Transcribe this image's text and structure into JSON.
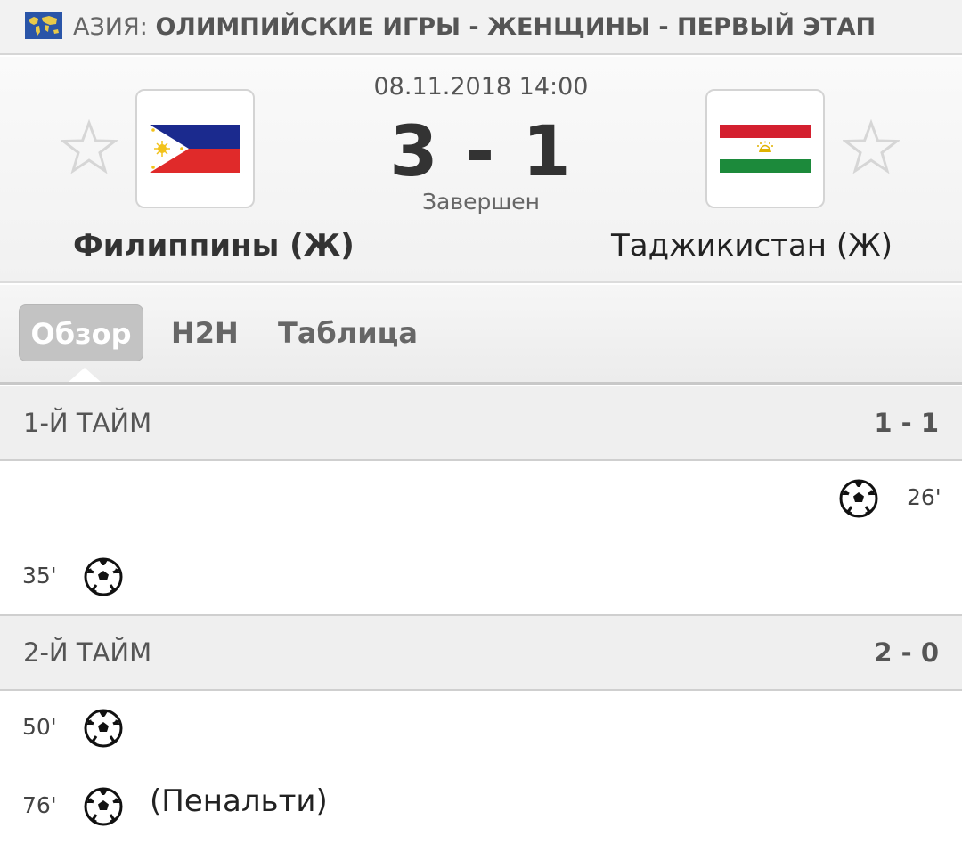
{
  "league": {
    "country": "АЗИЯ:",
    "name": "ОЛИМПИЙСКИЕ ИГРЫ - ЖЕНЩИНЫ - ПЕРВЫЙ ЭТАП",
    "icon": "world-map-icon"
  },
  "match": {
    "datetime": "08.11.2018 14:00",
    "score": "3 - 1",
    "status": "Завершен",
    "home": {
      "name": "Филиппины (Ж)",
      "flag": "philippines-flag"
    },
    "away": {
      "name": "Таджикистан (Ж)",
      "flag": "tajikistan-flag"
    }
  },
  "tabs": [
    {
      "label": "Обзор",
      "active": true
    },
    {
      "label": "H2H",
      "active": false
    },
    {
      "label": "Таблица",
      "active": false
    }
  ],
  "periods": [
    {
      "label": "1-Й ТАЙМ",
      "score": "1 - 1",
      "events": [
        {
          "side": "away",
          "minute": "26'",
          "type": "goal",
          "icon": "soccer-ball-icon"
        },
        {
          "side": "home",
          "minute": "35'",
          "type": "goal",
          "icon": "soccer-ball-icon"
        }
      ]
    },
    {
      "label": "2-Й ТАЙМ",
      "score": "2 - 0",
      "events": [
        {
          "side": "home",
          "minute": "50'",
          "type": "goal",
          "icon": "soccer-ball-icon"
        },
        {
          "side": "home",
          "minute": "76'",
          "type": "goal",
          "icon": "soccer-ball-icon",
          "note": "(Пенальти)"
        }
      ]
    }
  ],
  "colors": {
    "header_bg": "#f2f2f2",
    "active_tab_bg": "#c3c3c3",
    "period_bg": "#efefef"
  }
}
